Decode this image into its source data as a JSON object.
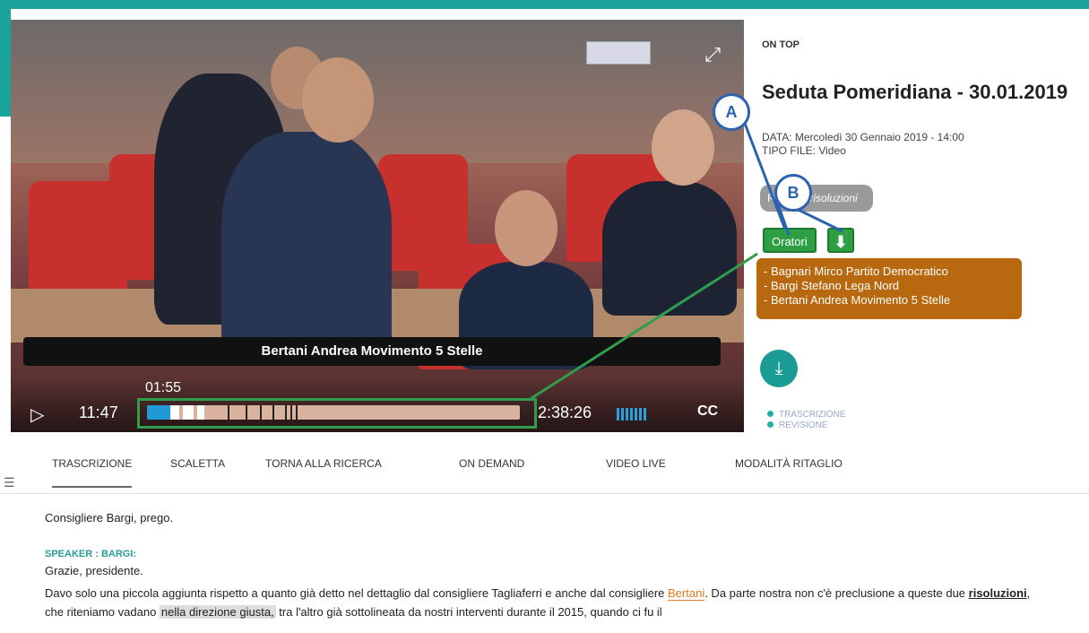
{
  "header": {
    "ontop_label": "ON TOP",
    "title": "Seduta Pomeridiana - 30.01.2019"
  },
  "meta": {
    "data_line": "DATA: Mercoledì 30 Gennaio 2019 - 14:00",
    "tipo_line": "TIPO FILE: Video"
  },
  "search_chip": {
    "prefix": "Ricerca: ",
    "term": "risoluzioni"
  },
  "buttons": {
    "oratori_label": "Oratori"
  },
  "speakers": [
    "- Bagnari Mirco Partito Democratico",
    "- Bargi Stefano Lega Nord",
    "- Bertani Andrea Movimento 5 Stelle"
  ],
  "legend": {
    "item1": "TRASCRIZIONE",
    "item2": "REVISIONE"
  },
  "callouts": {
    "a": "A",
    "b": "B"
  },
  "player": {
    "brand": "flowplayer",
    "caption": "Bertani Andrea Movimento 5 Stelle",
    "current_time": "11:47",
    "hover_time": "01:55",
    "total_time": "2:38:26",
    "cc_label": "CC",
    "progress_fraction": 0.074
  },
  "tabs": [
    "TRASCRIZIONE",
    "SCALETTA",
    "TORNA ALLA RICERCA",
    "ON DEMAND",
    "VIDEO LIVE",
    "MODALITÀ RITAGLIO"
  ],
  "transcript": {
    "line1": "Consigliere  Bargi, prego.",
    "speaker_label": "SPEAKER : BARGI:",
    "line2": "Grazie, presidente.",
    "para_a": "Davo solo  una piccola aggiunta  rispetto a quanto già  detto nel dettaglio  dal consigliere  Tagliaferri  e anche dal consigliere  ",
    "para_name": "Bertani",
    "para_b": ".  Da  parte nostra  non c'è preclusione  a queste due ",
    "para_bold": "risoluzioni",
    "para_c": ",  che riteniamo vadano  ",
    "para_gray": "nella direzione giusta,",
    "para_d": "  tra l'altro  già sottolineata  da  nostri interventi  durante il 2015,  quando  ci fu il"
  }
}
